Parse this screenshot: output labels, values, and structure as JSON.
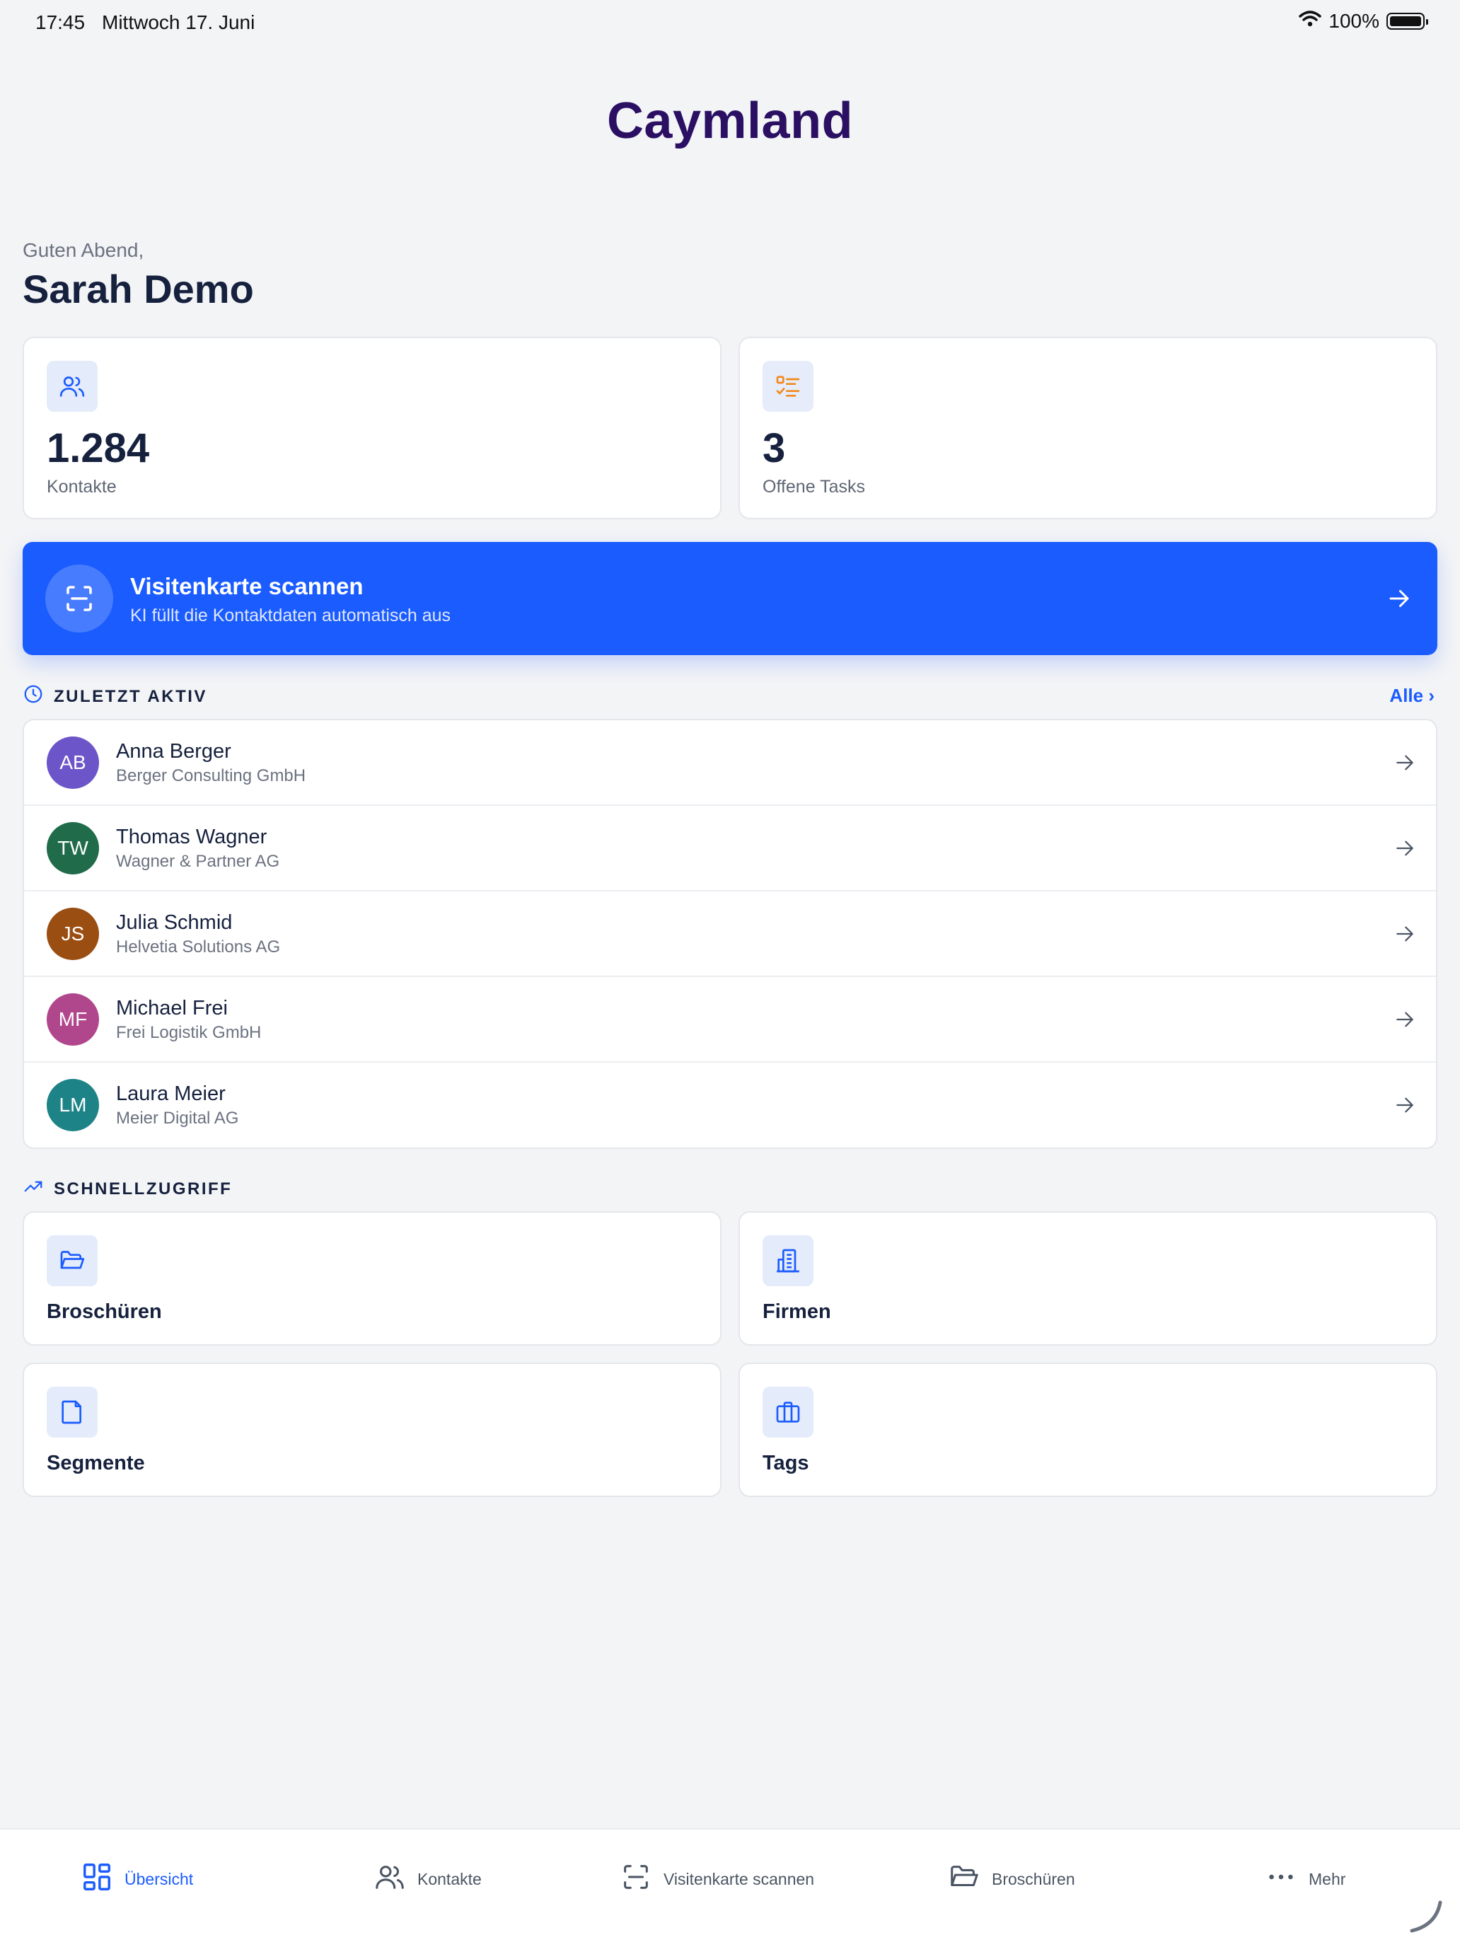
{
  "status_bar": {
    "time": "17:45",
    "date": "Mittwoch 17. Juni",
    "battery": "100%"
  },
  "app": {
    "title": "Caymland"
  },
  "greeting": {
    "salutation": "Guten Abend,",
    "name": "Sarah Demo"
  },
  "stats": [
    {
      "value": "1.284",
      "label": "Kontakte",
      "icon": "users-icon"
    },
    {
      "value": "3",
      "label": "Offene Tasks",
      "icon": "task-list-icon"
    }
  ],
  "scan_banner": {
    "title": "Visitenkarte scannen",
    "subtitle": "KI füllt die Kontaktdaten automatisch aus",
    "icon": "scan-icon"
  },
  "recent": {
    "title": "ZULETZT AKTIV",
    "see_all": "Alle ›",
    "contacts": [
      {
        "initials": "AB",
        "name": "Anna Berger",
        "company": "Berger Consulting GmbH",
        "color": "#6b55c8"
      },
      {
        "initials": "TW",
        "name": "Thomas Wagner",
        "company": "Wagner & Partner AG",
        "color": "#1f6b4a"
      },
      {
        "initials": "JS",
        "name": "Julia Schmid",
        "company": "Helvetia Solutions AG",
        "color": "#9a4e12"
      },
      {
        "initials": "MF",
        "name": "Michael Frei",
        "company": "Frei Logistik GmbH",
        "color": "#b0478c"
      },
      {
        "initials": "LM",
        "name": "Laura Meier",
        "company": "Meier Digital AG",
        "color": "#1e8387"
      }
    ]
  },
  "quick_access": {
    "title": "SCHNELLZUGRIFF",
    "items": [
      {
        "label": "Broschüren",
        "icon": "folder-open-icon"
      },
      {
        "label": "Firmen",
        "icon": "building-icon"
      },
      {
        "label": "Segmente",
        "icon": "file-icon"
      },
      {
        "label": "Tags",
        "icon": "briefcase-icon"
      }
    ]
  },
  "tab_bar": {
    "tabs": [
      {
        "label": "Übersicht",
        "icon": "grid-icon",
        "active": true
      },
      {
        "label": "Kontakte",
        "icon": "users-icon",
        "active": false
      },
      {
        "label": "Visitenkarte scannen",
        "icon": "scan-icon",
        "active": false
      },
      {
        "label": "Broschüren",
        "icon": "folder-open-icon",
        "active": false
      },
      {
        "label": "Mehr",
        "icon": "more-icon",
        "active": false
      }
    ]
  },
  "colors": {
    "accent": "#1b5cff",
    "brand": "#2a0f63",
    "background": "#f3f4f6"
  }
}
